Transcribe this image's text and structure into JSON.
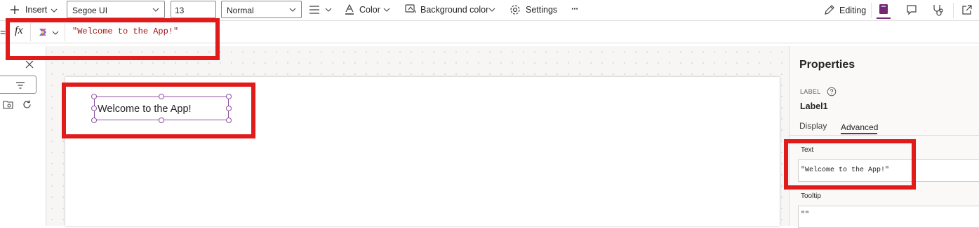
{
  "toolbar": {
    "insert_label": "Insert",
    "font_family": "Segoe UI",
    "font_size": "13",
    "font_weight": "Normal",
    "color_label": "Color",
    "background_color_label": "Background color",
    "settings_label": "Settings",
    "more_label": "···",
    "editing_label": "Editing"
  },
  "formula_bar": {
    "fx_label": "fx",
    "formula": "\"Welcome to the App!\""
  },
  "canvas": {
    "label_text": "Welcome to the App!"
  },
  "properties": {
    "title": "Properties",
    "control_type": "LABEL",
    "control_name": "Label1",
    "tabs": [
      "Display",
      "Advanced"
    ],
    "active_tab": "Advanced",
    "text_field_label": "Text",
    "text_field_value": "\"Welcome to the App!\"",
    "tooltip_field_label": "Tooltip",
    "tooltip_field_value": "\"\""
  },
  "colors": {
    "accent": "#742774",
    "highlight": "#e11a1a",
    "formula_string": "#a31515"
  }
}
